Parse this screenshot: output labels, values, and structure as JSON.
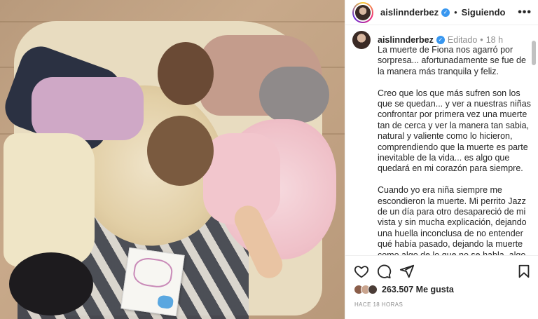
{
  "post": {
    "username": "aislinnderbez",
    "follow_label": "Siguiendo",
    "more_label": "•••"
  },
  "caption": {
    "username": "aislinnderbez",
    "edited_label": "Editado",
    "time": "18 h",
    "paragraphs": [
      "La muerte de Fiona nos agarró por sorpresa... afortunadamente se fue de la manera más tranquila y feliz.",
      "Creo que los que más sufren son los que se quedan... y ver a nuestras niñas confrontar por primera vez una muerte tan de cerca y ver la manera tan sabia, natural y valiente como lo hicieron, comprendiendo que la muerte es parte inevitable de la vida... es algo que quedará en mi corazón para siempre.",
      "Cuando yo era niña siempre me escondieron la muerte. Mi perrito Jazz de un día para otro desapareció de mi vista y sin mucha explicación, dejando una huella inconclusa de no entender qué había pasado, dejando la muerte como algo de lo que no se habla, algo"
    ]
  },
  "actions": {
    "likes": "263.507 Me gusta",
    "ago": "HACE 18 HORAS",
    "icons": [
      "heart-icon",
      "comment-icon",
      "share-icon",
      "bookmark-icon"
    ]
  },
  "colors": {
    "verified": "#3897f0",
    "muted": "#8e8e8e",
    "text": "#262626"
  }
}
